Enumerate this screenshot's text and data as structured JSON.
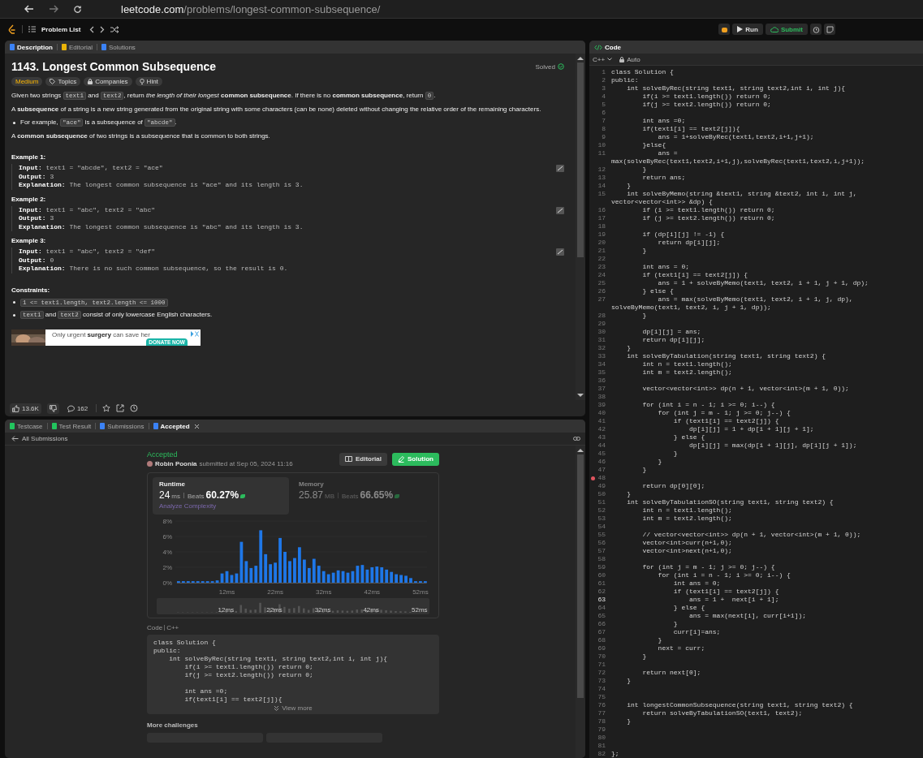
{
  "browser": {
    "url_host": "leetcode.com",
    "url_path": "/problems/longest-common-subsequence/"
  },
  "header": {
    "problem_list": "Problem List",
    "run": "Run",
    "submit": "Submit"
  },
  "description_panel": {
    "tabs": [
      {
        "label": "Description",
        "kind": "description",
        "selected": true
      },
      {
        "label": "Editorial",
        "kind": "editorial",
        "selected": false
      },
      {
        "label": "Solutions",
        "kind": "solutions",
        "selected": false
      }
    ],
    "title": "1143. Longest Common Subsequence",
    "status": "Solved",
    "tags": [
      {
        "label": "Medium",
        "kind": "difficulty"
      },
      {
        "label": "Topics",
        "kind": "topics"
      },
      {
        "label": "Companies",
        "kind": "companies"
      },
      {
        "label": "Hint",
        "kind": "hint"
      }
    ],
    "paragraphs": [
      {
        "kind": "paragraph",
        "segments": [
          {
            "kind": "text",
            "text": "Given two strings "
          },
          {
            "kind": "code",
            "text": "text1"
          },
          {
            "kind": "text",
            "text": " and "
          },
          {
            "kind": "code",
            "text": "text2"
          },
          {
            "kind": "text",
            "text": ", return *the length of their longest* **common subsequence**. If there is no **common subsequence**, return "
          },
          {
            "kind": "code",
            "text": "0"
          },
          {
            "kind": "text",
            "text": "."
          }
        ]
      },
      {
        "kind": "paragraph",
        "segments": [
          {
            "kind": "text",
            "text": "A **subsequence** of a string is a new string generated from the original string with some characters (can be none) deleted without changing the relative order of the remaining characters."
          }
        ]
      },
      {
        "kind": "bullet",
        "segments": [
          {
            "kind": "text",
            "text": "For example, "
          },
          {
            "kind": "code",
            "text": "\"ace\""
          },
          {
            "kind": "text",
            "text": " is a subsequence of "
          },
          {
            "kind": "code",
            "text": "\"abcde\""
          },
          {
            "kind": "text",
            "text": "."
          }
        ]
      },
      {
        "kind": "paragraph",
        "segments": [
          {
            "kind": "text",
            "text": "A **common subsequence** of two strings is a subsequence that is common to both strings."
          }
        ]
      }
    ],
    "examples": [
      {
        "heading": "Example 1:",
        "lines": [
          "**Input:** text1 = \"abcde\", text2 = \"ace\"",
          "**Output:** 3",
          "**Explanation:** The longest common subsequence is \"ace\" and its length is 3."
        ]
      },
      {
        "heading": "Example 2:",
        "lines": [
          "**Input:** text1 = \"abc\", text2 = \"abc\"",
          "**Output:** 3",
          "**Explanation:** The longest common subsequence is \"abc\" and its length is 3."
        ]
      },
      {
        "heading": "Example 3:",
        "lines": [
          "**Input:** text1 = \"abc\", text2 = \"def\"",
          "**Output:** 0",
          "**Explanation:** There is no such common subsequence, so the result is 0."
        ]
      }
    ],
    "constraints_heading": "Constraints:",
    "constraints": [
      {
        "segments": [
          {
            "kind": "code",
            "text": "1 <= text1.length, text2.length <= 1000"
          }
        ]
      },
      {
        "segments": [
          {
            "kind": "code",
            "text": "text1"
          },
          {
            "kind": "text",
            "text": " and "
          },
          {
            "kind": "code",
            "text": "text2"
          },
          {
            "kind": "text",
            "text": " consist of only lowercase English characters."
          }
        ]
      }
    ],
    "ad": {
      "text": "Only urgent **surgery** can save her",
      "button": "DONATE NOW"
    },
    "footer": {
      "likes": "13.6K",
      "comments": "162"
    }
  },
  "result_panel": {
    "tabs": [
      {
        "label": "Testcase",
        "kind": "testcase",
        "selected": false,
        "closable": false
      },
      {
        "label": "Test Result",
        "kind": "result",
        "selected": false,
        "closable": false
      },
      {
        "label": "Submissions",
        "kind": "submissions",
        "selected": false,
        "closable": false
      },
      {
        "label": "Accepted",
        "kind": "accepted",
        "selected": true,
        "closable": true
      }
    ],
    "back_link": "All Submissions",
    "status": "Accepted",
    "author": "Robin Poonia",
    "submitted": "submitted at Sep 05, 2024 11:16",
    "buttons": [
      {
        "label": "Editorial",
        "kind": "editorial"
      },
      {
        "label": "Solution",
        "kind": "solution"
      }
    ],
    "stats": [
      {
        "label": "Runtime",
        "value": "24",
        "unit": "ms",
        "beats_label": "Beats",
        "beats": "60.27%",
        "link": "Analyze Complexity",
        "selected": true
      },
      {
        "label": "Memory",
        "value": "25.87",
        "unit": "MB",
        "beats_label": "Beats",
        "beats": "66.65%",
        "selected": false
      }
    ],
    "chart_data": {
      "type": "bar",
      "x": [
        2,
        3,
        4,
        5,
        6,
        7,
        8,
        9,
        10,
        11,
        12,
        13,
        14,
        15,
        16,
        17,
        18,
        19,
        20,
        21,
        22,
        23,
        24,
        25,
        26,
        27,
        28,
        29,
        30,
        31,
        32,
        33,
        34,
        35,
        36,
        37,
        38,
        39,
        40,
        41,
        42,
        43,
        44,
        45,
        46,
        47,
        48,
        49,
        50,
        51,
        52,
        53
      ],
      "series": [
        {
          "color": "#1e77e8",
          "values": [
            0.2,
            0.2,
            0.2,
            0.2,
            0.2,
            0.2,
            0.2,
            0.2,
            0.3,
            1.2,
            1.5,
            1.0,
            1.2,
            5.3,
            2.8,
            1.9,
            2.2,
            6.8,
            3.7,
            2.4,
            2.6,
            5.8,
            4.0,
            2.8,
            3.2,
            4.6,
            3.0,
            1.9,
            3.1,
            2.2,
            1.5,
            1.1,
            1.3,
            1.6,
            1.5,
            1.3,
            1.5,
            2.2,
            2.3,
            1.7,
            2.0,
            2.1,
            2.0,
            1.7,
            1.4,
            1.1,
            1.0,
            0.9,
            0.6,
            0.2,
            0.2,
            0.2
          ]
        }
      ],
      "xticks": [
        {
          "value": 12,
          "label": "12ms"
        },
        {
          "value": 22,
          "label": "22ms"
        },
        {
          "value": 32,
          "label": "32ms"
        },
        {
          "value": 42,
          "label": "42ms"
        },
        {
          "value": 52,
          "label": "52ms"
        }
      ],
      "yticks": [
        {
          "value": 0,
          "label": "0%"
        },
        {
          "value": 2,
          "label": "2%"
        },
        {
          "value": 4,
          "label": "4%"
        },
        {
          "value": 6,
          "label": "6%"
        },
        {
          "value": 8,
          "label": "8%"
        }
      ],
      "xlim": [
        2,
        53
      ],
      "ylim": [
        0,
        8
      ]
    },
    "navigator_labels": [
      "12ms",
      "22ms",
      "32ms",
      "42ms",
      "52ms"
    ],
    "code_label": "Code",
    "code_language": "C++",
    "code_preview": "class Solution {\npublic:\n    int solveByRec(string text1, string text2,int i, int j){\n        if(i >= text1.length()) return 0;\n        if(j >= text2.length()) return 0;\n\n        int ans =0;\n        if(text1[i] == text2[j]){",
    "view_more": "View more",
    "more_challenges": "More challenges"
  },
  "editor": {
    "title": "Code",
    "language": "C++",
    "mode": "Auto",
    "lines": [
      {
        "number": "1",
        "text": "class Solution {",
        "breakpoint": false,
        "current": false
      },
      {
        "number": "2",
        "text": "public:",
        "breakpoint": false,
        "current": false
      },
      {
        "number": "3",
        "text": "    int solveByRec(string text1, string text2,int i, int j){",
        "breakpoint": false,
        "current": false
      },
      {
        "number": "4",
        "text": "        if(i >= text1.length()) return 0;",
        "breakpoint": false,
        "current": false
      },
      {
        "number": "5",
        "text": "        if(j >= text2.length()) return 0;",
        "breakpoint": false,
        "current": false
      },
      {
        "number": "6",
        "breakpoint": false,
        "current": false
      },
      {
        "number": "7",
        "text": "        int ans =0;",
        "breakpoint": false,
        "current": false
      },
      {
        "number": "8",
        "text": "        if(text1[i] == text2[j]){",
        "breakpoint": false,
        "current": false
      },
      {
        "number": "9",
        "text": "            ans = 1+solveByRec(text1,text2,i+1,j+1);",
        "breakpoint": false,
        "current": false
      },
      {
        "number": "10",
        "text": "        }else{",
        "breakpoint": false,
        "current": false
      },
      {
        "number": "11",
        "text": "            ans = max(solveByRec(text1,text2,i+1,j),solveByRec(text1,text2,i,j+1));",
        "breakpoint": false,
        "current": false
      },
      {
        "number": "12",
        "text": "        }",
        "breakpoint": false,
        "current": false
      },
      {
        "number": "13",
        "text": "        return ans;",
        "breakpoint": false,
        "current": false
      },
      {
        "number": "14",
        "text": "    }",
        "breakpoint": false,
        "current": false
      },
      {
        "number": "15",
        "text": "    int solveByMemo(string &text1, string &text2, int i, int j, vector<vector<int>> &dp) {",
        "breakpoint": false,
        "current": false
      },
      {
        "number": "16",
        "text": "        if (i >= text1.length()) return 0;",
        "breakpoint": false,
        "current": false
      },
      {
        "number": "17",
        "text": "        if (j >= text2.length()) return 0;",
        "breakpoint": false,
        "current": false
      },
      {
        "number": "18",
        "breakpoint": false,
        "current": false
      },
      {
        "number": "19",
        "text": "        if (dp[i][j] != -1) {",
        "breakpoint": false,
        "current": false
      },
      {
        "number": "20",
        "text": "            return dp[i][j];",
        "breakpoint": false,
        "current": false
      },
      {
        "number": "21",
        "text": "        }",
        "breakpoint": false,
        "current": false
      },
      {
        "number": "22",
        "breakpoint": false,
        "current": false
      },
      {
        "number": "23",
        "text": "        int ans = 0;",
        "breakpoint": false,
        "current": false
      },
      {
        "number": "24",
        "text": "        if (text1[i] == text2[j]) {",
        "breakpoint": false,
        "current": false
      },
      {
        "number": "25",
        "text": "            ans = 1 + solveByMemo(text1, text2, i + 1, j + 1, dp);",
        "breakpoint": false,
        "current": false
      },
      {
        "number": "26",
        "text": "        } else {",
        "breakpoint": false,
        "current": false
      },
      {
        "number": "27",
        "text": "            ans = max(solveByMemo(text1, text2, i + 1, j, dp), solveByMemo(text1, text2, i, j + 1, dp));",
        "breakpoint": false,
        "current": false
      },
      {
        "number": "28",
        "text": "        }",
        "breakpoint": false,
        "current": false
      },
      {
        "number": "29",
        "breakpoint": false,
        "current": false
      },
      {
        "number": "30",
        "text": "        dp[i][j] = ans;",
        "breakpoint": false,
        "current": false
      },
      {
        "number": "31",
        "text": "        return dp[i][j];",
        "breakpoint": false,
        "current": false
      },
      {
        "number": "32",
        "text": "    }",
        "breakpoint": false,
        "current": false
      },
      {
        "number": "33",
        "text": "    int solveByTabulation(string text1, string text2) {",
        "breakpoint": false,
        "current": false
      },
      {
        "number": "34",
        "text": "        int n = text1.length();",
        "breakpoint": false,
        "current": false
      },
      {
        "number": "35",
        "text": "        int m = text2.length();",
        "breakpoint": false,
        "current": false
      },
      {
        "number": "36",
        "breakpoint": false,
        "current": false
      },
      {
        "number": "37",
        "text": "        vector<vector<int>> dp(n + 1, vector<int>(m + 1, 0));",
        "breakpoint": false,
        "current": false
      },
      {
        "number": "38",
        "breakpoint": false,
        "current": false
      },
      {
        "number": "39",
        "text": "        for (int i = n - 1; i >= 0; i--) {",
        "breakpoint": false,
        "current": false
      },
      {
        "number": "40",
        "text": "            for (int j = m - 1; j >= 0; j--) {",
        "breakpoint": false,
        "current": false
      },
      {
        "number": "41",
        "text": "                if (text1[i] == text2[j]) {",
        "breakpoint": false,
        "current": false
      },
      {
        "number": "42",
        "text": "                    dp[i][j] = 1 + dp[i + 1][j + 1];",
        "breakpoint": false,
        "current": false
      },
      {
        "number": "43",
        "text": "                } else {",
        "breakpoint": false,
        "current": false
      },
      {
        "number": "44",
        "text": "                    dp[i][j] = max(dp[i + 1][j], dp[i][j + 1]);",
        "breakpoint": false,
        "current": false
      },
      {
        "number": "45",
        "text": "                }",
        "breakpoint": false,
        "current": false
      },
      {
        "number": "46",
        "text": "            }",
        "breakpoint": false,
        "current": false
      },
      {
        "number": "47",
        "text": "        }",
        "breakpoint": false,
        "current": false
      },
      {
        "number": "48",
        "breakpoint": true,
        "current": false
      },
      {
        "number": "49",
        "text": "        return dp[0][0];",
        "breakpoint": false,
        "current": false
      },
      {
        "number": "50",
        "text": "    }",
        "breakpoint": false,
        "current": false
      },
      {
        "number": "51",
        "text": "    int solveByTabulationSO(string text1, string text2) {",
        "breakpoint": false,
        "current": false
      },
      {
        "number": "52",
        "text": "        int n = text1.length();",
        "breakpoint": false,
        "current": false
      },
      {
        "number": "53",
        "text": "        int m = text2.length();",
        "breakpoint": false,
        "current": false
      },
      {
        "number": "54",
        "breakpoint": false,
        "current": false
      },
      {
        "number": "55",
        "text": "        // vector<vector<int>> dp(n + 1, vector<int>(m + 1, 0));",
        "breakpoint": false,
        "current": false
      },
      {
        "number": "56",
        "text": "        vector<int>curr(n+1,0);",
        "breakpoint": false,
        "current": false
      },
      {
        "number": "57",
        "text": "        vector<int>next(n+1,0);",
        "breakpoint": false,
        "current": false
      },
      {
        "number": "58",
        "breakpoint": false,
        "current": false
      },
      {
        "number": "59",
        "text": "        for (int j = m - 1; j >= 0; j--) {",
        "breakpoint": false,
        "current": false
      },
      {
        "number": "60",
        "text": "            for (int i = n - 1; i >= 0; i--) {",
        "breakpoint": false,
        "current": false
      },
      {
        "number": "61",
        "text": "                int ans = 0;",
        "breakpoint": false,
        "current": false
      },
      {
        "number": "62",
        "text": "                if (text1[i] == text2[j]) {",
        "breakpoint": false,
        "current": false
      },
      {
        "number": "63",
        "text": "                    ans = 1 +  next[i + 1];",
        "breakpoint": false,
        "current": true
      },
      {
        "number": "64",
        "text": "                } else {",
        "breakpoint": false,
        "current": false
      },
      {
        "number": "65",
        "text": "                    ans = max(next[i], curr[i+1]);",
        "breakpoint": false,
        "current": false
      },
      {
        "number": "66",
        "text": "                }",
        "breakpoint": false,
        "current": false
      },
      {
        "number": "67",
        "text": "                curr[i]=ans;",
        "breakpoint": false,
        "current": false
      },
      {
        "number": "68",
        "text": "            }",
        "breakpoint": false,
        "current": false
      },
      {
        "number": "69",
        "text": "            next = curr;",
        "breakpoint": false,
        "current": false
      },
      {
        "number": "70",
        "text": "        }",
        "breakpoint": false,
        "current": false
      },
      {
        "number": "71",
        "breakpoint": false,
        "current": false
      },
      {
        "number": "72",
        "text": "        return next[0];",
        "breakpoint": false,
        "current": false
      },
      {
        "number": "73",
        "text": "    }",
        "breakpoint": false,
        "current": false
      },
      {
        "number": "74",
        "breakpoint": false,
        "current": false
      },
      {
        "number": "75",
        "breakpoint": false,
        "current": false
      },
      {
        "number": "76",
        "text": "    int longestCommonSubsequence(string text1, string text2) {",
        "breakpoint": false,
        "current": false
      },
      {
        "number": "77",
        "text": "        return solveByTabulationSO(text1, text2);",
        "breakpoint": false,
        "current": false
      },
      {
        "number": "78",
        "text": "    }",
        "breakpoint": false,
        "current": false
      },
      {
        "number": "79",
        "breakpoint": false,
        "current": false
      },
      {
        "number": "80",
        "breakpoint": false,
        "current": false
      },
      {
        "number": "81",
        "breakpoint": false,
        "current": false
      },
      {
        "number": "82",
        "text": "};",
        "breakpoint": false,
        "current": false
      }
    ]
  }
}
